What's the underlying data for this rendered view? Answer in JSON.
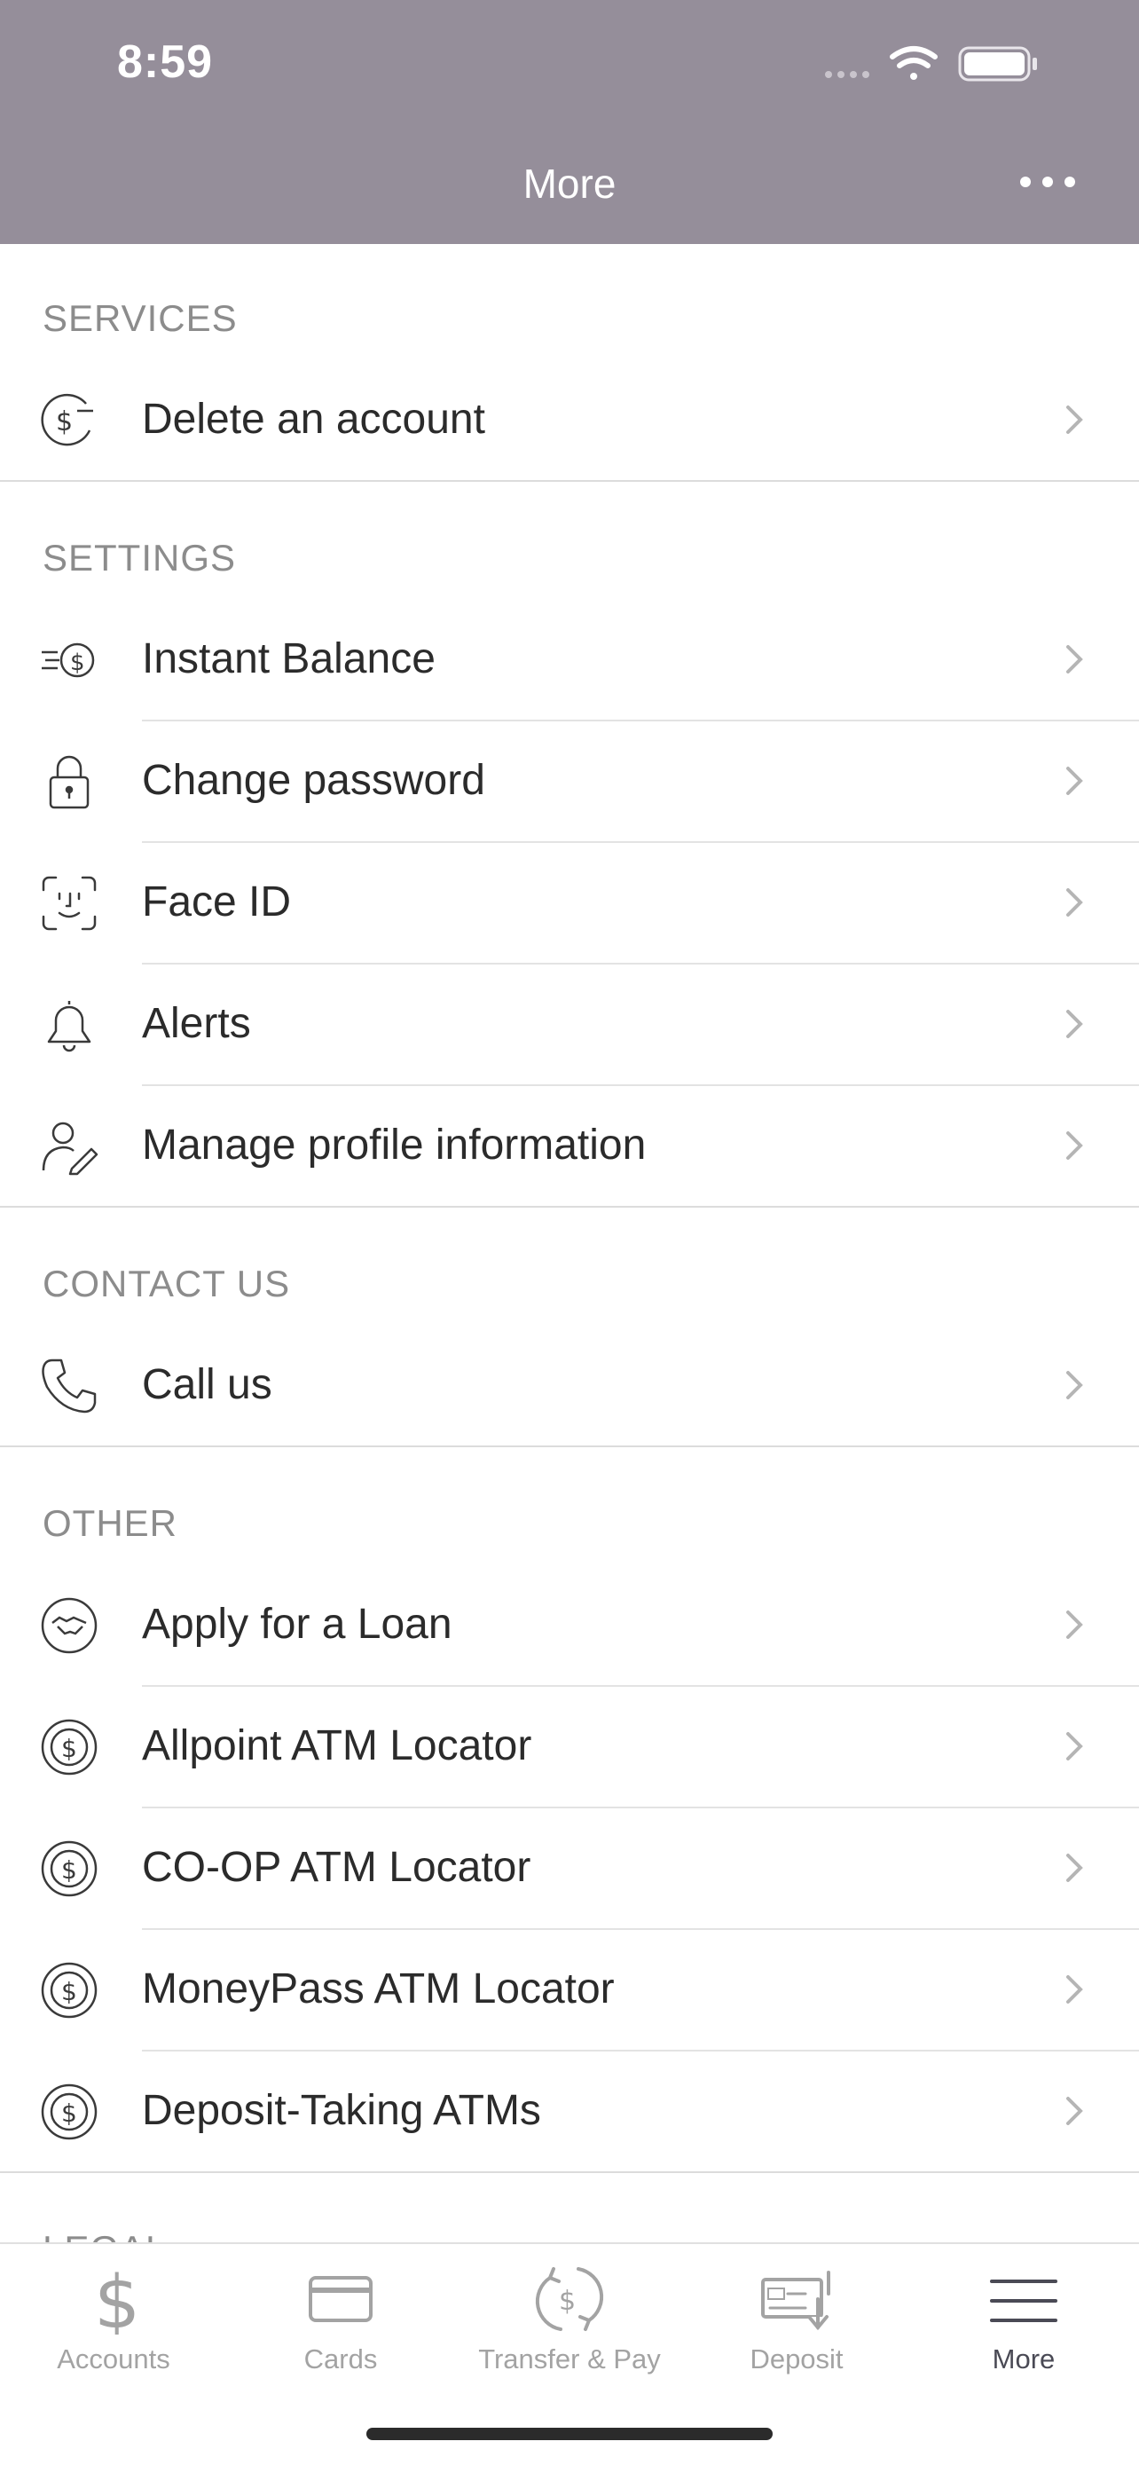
{
  "status_bar": {
    "time": "8:59"
  },
  "header": {
    "title": "More"
  },
  "sections": {
    "services": {
      "title": "SERVICES",
      "items": [
        {
          "label": "Delete an account",
          "icon": "dollar-minus-icon"
        }
      ]
    },
    "settings": {
      "title": "SETTINGS",
      "items": [
        {
          "label": "Instant Balance",
          "icon": "instant-balance-icon"
        },
        {
          "label": "Change password",
          "icon": "lock-icon"
        },
        {
          "label": "Face ID",
          "icon": "face-id-icon"
        },
        {
          "label": "Alerts",
          "icon": "bell-icon"
        },
        {
          "label": "Manage profile information",
          "icon": "profile-edit-icon"
        }
      ]
    },
    "contact": {
      "title": "CONTACT US",
      "items": [
        {
          "label": "Call us",
          "icon": "phone-icon"
        }
      ]
    },
    "other": {
      "title": "OTHER",
      "items": [
        {
          "label": "Apply for a Loan",
          "icon": "handshake-icon"
        },
        {
          "label": "Allpoint ATM Locator",
          "icon": "dollar-circle-icon"
        },
        {
          "label": "CO-OP ATM Locator",
          "icon": "dollar-circle-icon"
        },
        {
          "label": "MoneyPass ATM Locator",
          "icon": "dollar-circle-icon"
        },
        {
          "label": "Deposit-Taking ATMs",
          "icon": "dollar-circle-icon"
        }
      ]
    },
    "legal": {
      "title": "LEGAL"
    }
  },
  "tabbar": {
    "tabs": [
      {
        "label": "Accounts",
        "icon": "dollar-icon"
      },
      {
        "label": "Cards",
        "icon": "card-icon"
      },
      {
        "label": "Transfer & Pay",
        "icon": "transfer-icon"
      },
      {
        "label": "Deposit",
        "icon": "check-deposit-icon"
      },
      {
        "label": "More",
        "icon": "menu-icon"
      }
    ],
    "active": "More"
  },
  "colors": {
    "header_bg": "#958e9a",
    "section_header": "#8c8c8c",
    "text": "#2b2b2b",
    "tab_inactive": "#a3a3a3",
    "tab_active": "#4a4a55"
  }
}
